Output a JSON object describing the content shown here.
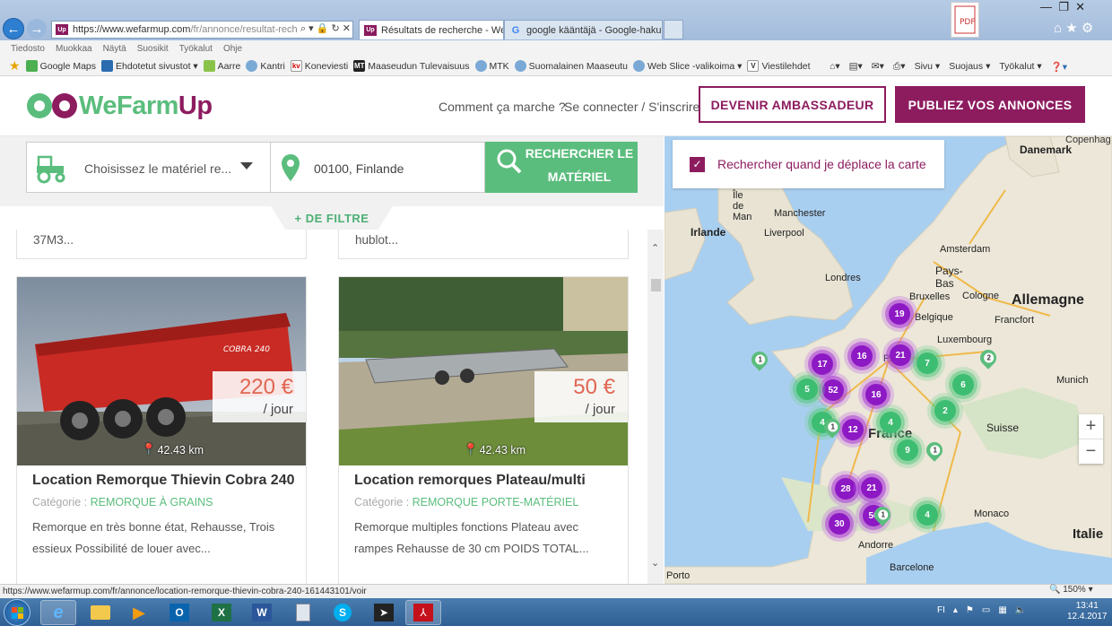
{
  "browser": {
    "url_host": "https://www.wefarmup.com",
    "url_path": "/fr/annonce/resultat-recherche",
    "tabs": [
      {
        "label": "Résultats de recherche - We..."
      },
      {
        "label": "google kääntäjä - Google-haku"
      }
    ],
    "menu": [
      "Tiedosto",
      "Muokkaa",
      "Näytä",
      "Suosikit",
      "Työkalut",
      "Ohje"
    ],
    "favorites": [
      "Google Maps",
      "Ehdotetut sivustot ▾",
      "Aarre",
      "Kantri",
      "Koneviesti",
      "Maaseudun Tulevaisuus",
      "MTK",
      "Suomalainen Maaseutu",
      "Web Slice -valikoima ▾",
      "Viestilehdet"
    ],
    "favicon_labels": [
      "",
      "",
      "",
      "",
      "kv",
      "MT",
      "",
      "",
      "",
      "V"
    ],
    "command_bar": [
      "Sivu ▾",
      "Suojaus ▾",
      "Työkalut ▾"
    ],
    "status_url": "https://www.wefarmup.com/fr/annonce/location-remorque-thievin-cobra-240-161443101/voir",
    "zoom": "150%"
  },
  "header": {
    "logo_we": "WeFarm",
    "logo_up": "Up",
    "how_it_works": "Comment ça marche ?",
    "login": "Se connecter / S'inscrire",
    "btn_ambassador": "DEVENIR AMBASSADEUR",
    "btn_publish": "PUBLIEZ VOS ANNONCES"
  },
  "search": {
    "equipment_placeholder": "Choisissez le matériel re...",
    "location": "00100, Finlande",
    "button": "RECHERCHER LE MATÉRIEL",
    "filter": "+ DE FILTRE"
  },
  "listings": {
    "prev_snippets": [
      "37M3...",
      "hublot..."
    ],
    "cards": [
      {
        "price": "220 €",
        "unit": "/ jour",
        "distance": "42.43 km",
        "title": "Location Remorque Thievin Cobra 240",
        "category_label": "Catégorie :",
        "category": "REMORQUE À GRAINS",
        "description": "Remorque en très bonne état, Rehausse, Trois essieux Possibilité de louer avec..."
      },
      {
        "price": "50 €",
        "unit": "/ jour",
        "distance": "42.43 km",
        "title": "Location remorques Plateau/multi",
        "category_label": "Catégorie :",
        "category": "REMORQUE PORTE-MATÉRIEL",
        "description": "Remorque multiples fonctions Plateau avec rampes Rehausse de 30 cm POIDS TOTAL..."
      }
    ]
  },
  "map": {
    "checkbox_label": "Rechercher quand je déplace la carte",
    "labels": [
      "Danemark",
      "Copenhag",
      "Île de Man",
      "Manchester",
      "Liverpool",
      "Irlande",
      "Amsterdam",
      "Pays-Bas",
      "Londres",
      "Bruxelles",
      "Cologne",
      "Belgique",
      "Allemagne",
      "Francfort",
      "Luxembourg",
      "Paris",
      "Munich",
      "Suisse",
      "France",
      "Monaco",
      "Italie",
      "Andorre",
      "Barcelone",
      "Porto"
    ],
    "clusters_purple": [
      "19",
      "17",
      "16",
      "21",
      "52",
      "16",
      "12",
      "28",
      "21",
      "30",
      "50"
    ],
    "clusters_green": [
      "7",
      "5",
      "6",
      "2",
      "4",
      "4",
      "9",
      "4"
    ],
    "pins": [
      "1",
      "2",
      "1",
      "1",
      "1"
    ],
    "zoom_in": "+",
    "zoom_out": "−"
  },
  "taskbar": {
    "lang": "FI",
    "time": "13:41",
    "date": "12.4.2017"
  },
  "colors": {
    "brand": "#8d1c5f",
    "accent_green": "#5bbd7d",
    "price": "#e06651"
  }
}
